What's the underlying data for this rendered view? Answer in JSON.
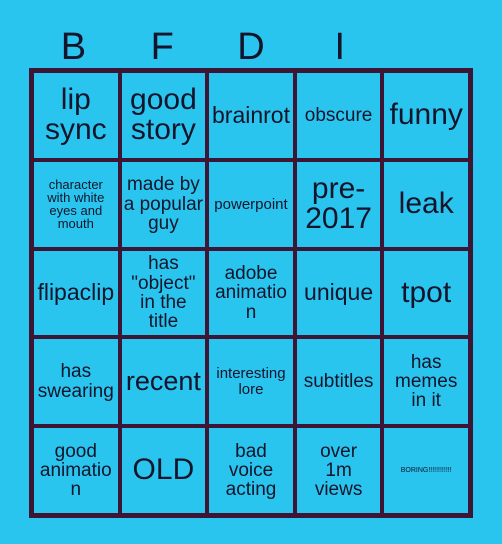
{
  "card": {
    "background_color": "#29c5ee",
    "grid_line_color": "#3d1535",
    "cell_fill_color": "#29c5ee",
    "text_color": "#14142b",
    "title_letters": "BFDI"
  },
  "header": {
    "columns": [
      {
        "label": "B"
      },
      {
        "label": "F"
      },
      {
        "label": "D"
      },
      {
        "label": "I"
      },
      {
        "label": ""
      }
    ]
  },
  "grid": {
    "rows": 5,
    "columns": 5,
    "cells": [
      {
        "text": "lip\nsync",
        "size": "fs-xxl"
      },
      {
        "text": "good\nstory",
        "size": "fs-xxl"
      },
      {
        "text": "brainrot",
        "size": "fs-lg"
      },
      {
        "text": "obscure",
        "size": "fs-md"
      },
      {
        "text": "funny",
        "size": "fs-xxl"
      },
      {
        "text": "character\nwith white\neyes and\nmouth",
        "size": "fs-xs"
      },
      {
        "text": "made by\na popular\nguy",
        "size": "fs-md"
      },
      {
        "text": "powerpoint",
        "size": "fs-sm"
      },
      {
        "text": "pre-\n2017",
        "size": "fs-xxl"
      },
      {
        "text": "leak",
        "size": "fs-xxl"
      },
      {
        "text": "flipaclip",
        "size": "fs-lg"
      },
      {
        "text": "has\n\"object\"\nin the title",
        "size": "fs-md"
      },
      {
        "text": "adobe\nanimation",
        "size": "fs-md"
      },
      {
        "text": "unique",
        "size": "fs-lg"
      },
      {
        "text": "tpot",
        "size": "fs-xxl"
      },
      {
        "text": "has\nswearing",
        "size": "fs-md"
      },
      {
        "text": "recent",
        "size": "fs-xl"
      },
      {
        "text": "interesting\nlore",
        "size": "fs-sm"
      },
      {
        "text": "subtitles",
        "size": "fs-md"
      },
      {
        "text": "has\nmemes\nin it",
        "size": "fs-md"
      },
      {
        "text": "good\nanimation",
        "size": "fs-md"
      },
      {
        "text": "OLD",
        "size": "fs-xxl"
      },
      {
        "text": "bad\nvoice\nacting",
        "size": "fs-md"
      },
      {
        "text": "over\n1m\nviews",
        "size": "fs-md"
      },
      {
        "text": "BORING!!!!!!!!!!!!",
        "size": "fs-xxs"
      }
    ]
  }
}
